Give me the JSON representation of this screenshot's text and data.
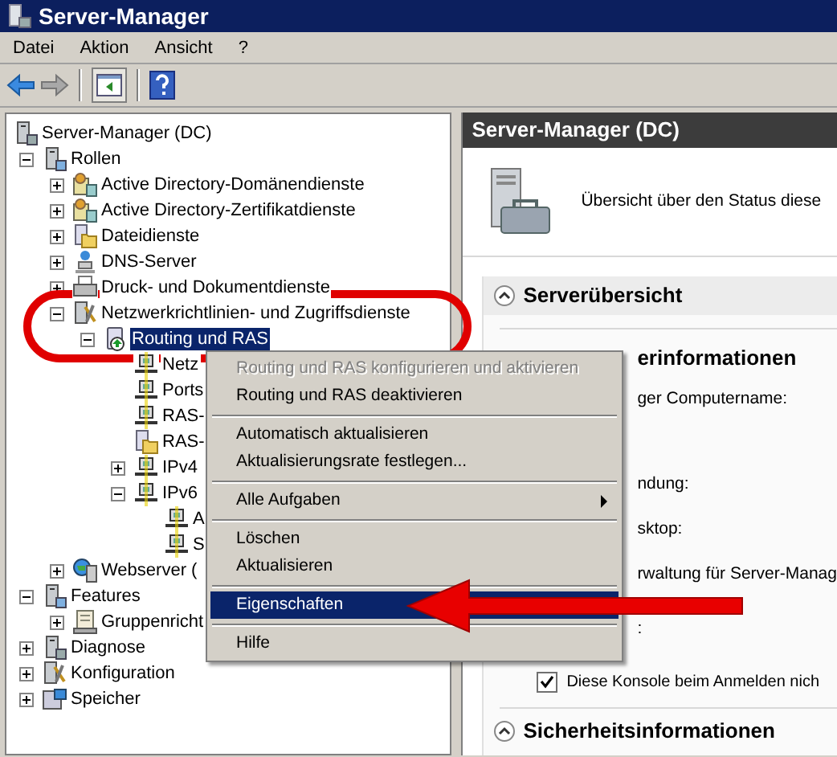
{
  "window": {
    "title": "Server-Manager"
  },
  "menu_bar": [
    "Datei",
    "Aktion",
    "Ansicht",
    "?"
  ],
  "tree": [
    {
      "label": "Server-Manager (DC)",
      "kind": "server",
      "selected": false,
      "children": [
        {
          "label": "Rollen",
          "kind": "roles",
          "expanded": true,
          "selected": false,
          "children": [
            {
              "label": "Active Directory-Domänendienste",
              "kind": "ad",
              "expanded": false,
              "selected": false
            },
            {
              "label": "Active Directory-Zertifikatdienste",
              "kind": "ad",
              "expanded": false,
              "selected": false
            },
            {
              "label": "Dateidienste",
              "kind": "folder",
              "expanded": false,
              "selected": false
            },
            {
              "label": "DNS-Server",
              "kind": "network",
              "expanded": false,
              "selected": false
            },
            {
              "label": "Druck- und Dokumentdienste",
              "kind": "printer",
              "expanded": false,
              "selected": false
            },
            {
              "label": "Netzwerkrichtlinien- und Zugriffsdienste",
              "kind": "tools",
              "expanded": true,
              "selected": false,
              "children": [
                {
                  "label": "Routing und RAS",
                  "kind": "routing",
                  "expanded": true,
                  "selected": true,
                  "children": [
                    {
                      "label": "Netz",
                      "kind": "computer",
                      "selected": false
                    },
                    {
                      "label": "Ports",
                      "kind": "computer",
                      "selected": false
                    },
                    {
                      "label": "RAS-",
                      "kind": "computer",
                      "selected": false
                    },
                    {
                      "label": "RAS-",
                      "kind": "folder",
                      "selected": false
                    },
                    {
                      "label": "IPv4",
                      "kind": "computer",
                      "expanded": false,
                      "selected": false
                    },
                    {
                      "label": "IPv6",
                      "kind": "computer",
                      "expanded": true,
                      "selected": false,
                      "children": [
                        {
                          "label": "A",
                          "kind": "computer",
                          "selected": false
                        },
                        {
                          "label": "S",
                          "kind": "computer",
                          "selected": false
                        }
                      ]
                    }
                  ]
                }
              ]
            },
            {
              "label": "Webserver (",
              "kind": "globe",
              "expanded": false,
              "selected": false
            }
          ]
        },
        {
          "label": "Features",
          "kind": "roles",
          "expanded": true,
          "selected": false,
          "children": [
            {
              "label": "Gruppenricht",
              "kind": "policy",
              "expanded": false,
              "selected": false
            }
          ]
        },
        {
          "label": "Diagnose",
          "kind": "server",
          "expanded": false,
          "selected": false
        },
        {
          "label": "Konfiguration",
          "kind": "tools",
          "expanded": false,
          "selected": false
        },
        {
          "label": "Speicher",
          "kind": "storage",
          "expanded": false,
          "selected": false
        }
      ]
    }
  ],
  "details_pane": {
    "header": "Server-Manager (DC)",
    "intro": "Übersicht über den Status diese",
    "sections": [
      {
        "title": "Serverübersicht",
        "subheading": "erinformationen",
        "lines": [
          "ger Computername:",
          "ndung:",
          "sktop:",
          "rwaltung für Server-Manag",
          ":"
        ],
        "checkbox": {
          "label": "Diese Konsole beim Anmelden nich",
          "checked": true
        }
      },
      {
        "title": "Sicherheitsinformationen"
      }
    ]
  },
  "context_menu": [
    {
      "kind": "item",
      "label": "Routing und RAS konfigurieren und aktivieren",
      "disabled": true,
      "selected": false
    },
    {
      "kind": "item",
      "label": "Routing und RAS deaktivieren",
      "disabled": false,
      "selected": false
    },
    {
      "kind": "separator"
    },
    {
      "kind": "item",
      "label": "Automatisch aktualisieren",
      "disabled": false,
      "selected": false
    },
    {
      "kind": "item",
      "label": "Aktualisierungsrate festlegen...",
      "disabled": false,
      "selected": false
    },
    {
      "kind": "separator"
    },
    {
      "kind": "item",
      "label": "Alle Aufgaben",
      "disabled": false,
      "selected": false,
      "submenu": true
    },
    {
      "kind": "separator"
    },
    {
      "kind": "item",
      "label": "Löschen",
      "disabled": false,
      "selected": false
    },
    {
      "kind": "item",
      "label": "Aktualisieren",
      "disabled": false,
      "selected": false
    },
    {
      "kind": "separator"
    },
    {
      "kind": "item",
      "label": "Eigenschaften",
      "disabled": false,
      "selected": true
    },
    {
      "kind": "separator"
    },
    {
      "kind": "item",
      "label": "Hilfe",
      "disabled": false,
      "selected": false
    }
  ]
}
